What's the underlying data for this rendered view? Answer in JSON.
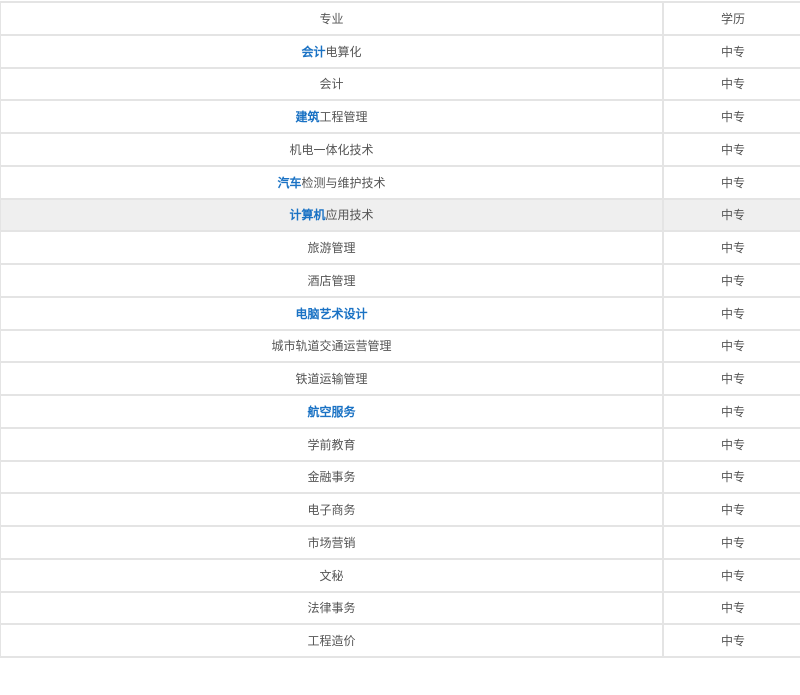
{
  "table": {
    "header": {
      "major": "专业",
      "level": "学历"
    },
    "rows": [
      {
        "link": "会计",
        "rest": "电算化",
        "level": "中专"
      },
      {
        "link": "",
        "rest": "会计",
        "level": "中专"
      },
      {
        "link": "建筑",
        "rest": "工程管理",
        "level": "中专"
      },
      {
        "link": "",
        "rest": "机电一体化技术",
        "level": "中专"
      },
      {
        "link": "汽车",
        "rest": "检测与维护技术",
        "level": "中专"
      },
      {
        "link": "计算机",
        "rest": "应用技术",
        "level": "中专",
        "highlight": true
      },
      {
        "link": "",
        "rest": "旅游管理",
        "level": "中专"
      },
      {
        "link": "",
        "rest": "酒店管理",
        "level": "中专"
      },
      {
        "link": "电脑艺术设计",
        "rest": "",
        "level": "中专"
      },
      {
        "link": "",
        "rest": "城市轨道交通运营管理",
        "level": "中专"
      },
      {
        "link": "",
        "rest": "铁道运输管理",
        "level": "中专"
      },
      {
        "link": "航空服务",
        "rest": "",
        "level": "中专"
      },
      {
        "link": "",
        "rest": "学前教育",
        "level": "中专"
      },
      {
        "link": "",
        "rest": "金融事务",
        "level": "中专"
      },
      {
        "link": "",
        "rest": "电子商务",
        "level": "中专"
      },
      {
        "link": "",
        "rest": "市场营销",
        "level": "中专"
      },
      {
        "link": "",
        "rest": "文秘",
        "level": "中专"
      },
      {
        "link": "",
        "rest": "法律事务",
        "level": "中专"
      },
      {
        "link": "",
        "rest": "工程造价",
        "level": "中专"
      }
    ]
  },
  "colors": {
    "link": "#1a72c4",
    "text": "#555555",
    "border": "#e4e4e4",
    "highlight_row": "#efefef"
  }
}
